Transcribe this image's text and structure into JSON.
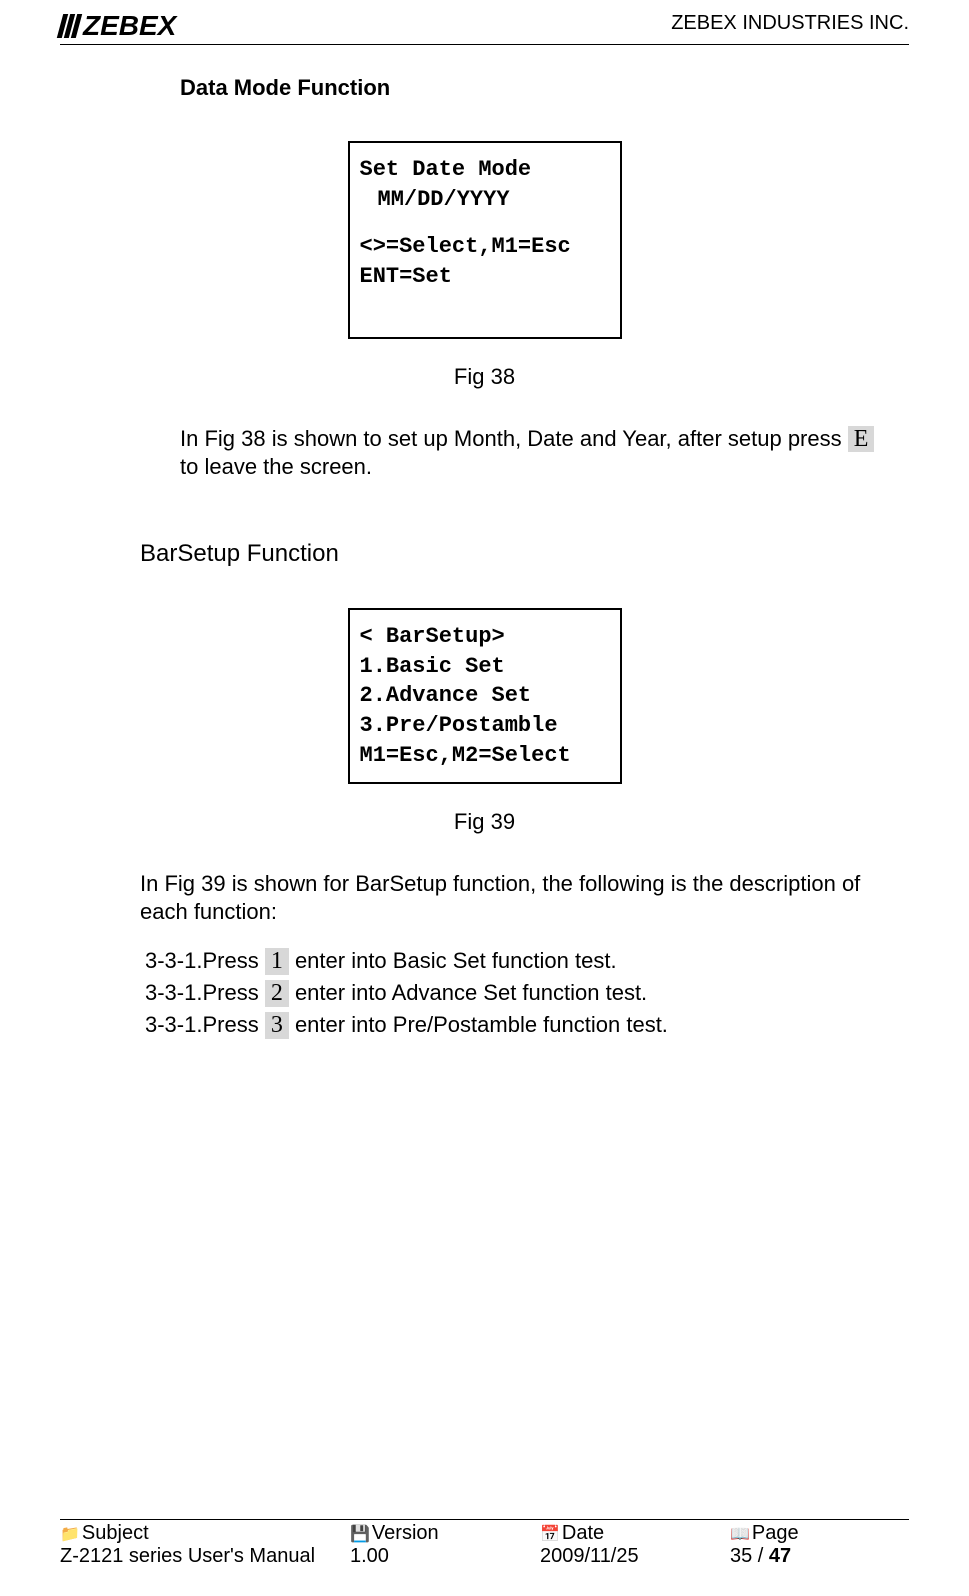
{
  "header": {
    "logo_text": "ZEBEX",
    "company": "ZEBEX INDUSTRIES INC."
  },
  "section1": {
    "title": "Data Mode Function",
    "lcd": {
      "l1": "Set Date Mode",
      "l2": "MM/DD/YYYY",
      "l3": "<>=Select,M1=Esc",
      "l4": "ENT=Set"
    },
    "caption": "Fig 38",
    "para_a": "In Fig 38 is shown to set up Month, Date and Year, after setup press",
    "key": "E",
    "para_b": " to leave the screen."
  },
  "section2": {
    "title": "BarSetup Function",
    "lcd": {
      "l1": "< BarSetup>",
      "l2": "1.Basic Set",
      "l3": "2.Advance Set",
      "l4": "3.Pre/Postamble",
      "l5": "M1=Esc,M2=Select"
    },
    "caption": "Fig 39",
    "para": "In Fig 39 is shown for BarSetup function, the following is the description of each function:",
    "items": [
      {
        "prefix": "3-3-1.Press ",
        "key": "1",
        "suffix": "  enter into Basic Set function test."
      },
      {
        "prefix": "3-3-1.Press ",
        "key": "2",
        "suffix": "  enter into Advance Set function test."
      },
      {
        "prefix": "3-3-1.Press ",
        "key": "3",
        "suffix": "  enter into Pre/Postamble function test."
      }
    ]
  },
  "footer": {
    "labels": {
      "subject": "Subject",
      "version": "Version",
      "date": "Date",
      "page": "Page"
    },
    "values": {
      "subject": "Z-2121 series User's Manual",
      "version": "1.00",
      "date": "2009/11/25",
      "page_cur": "35",
      "page_sep": " / ",
      "page_total": "47"
    }
  }
}
